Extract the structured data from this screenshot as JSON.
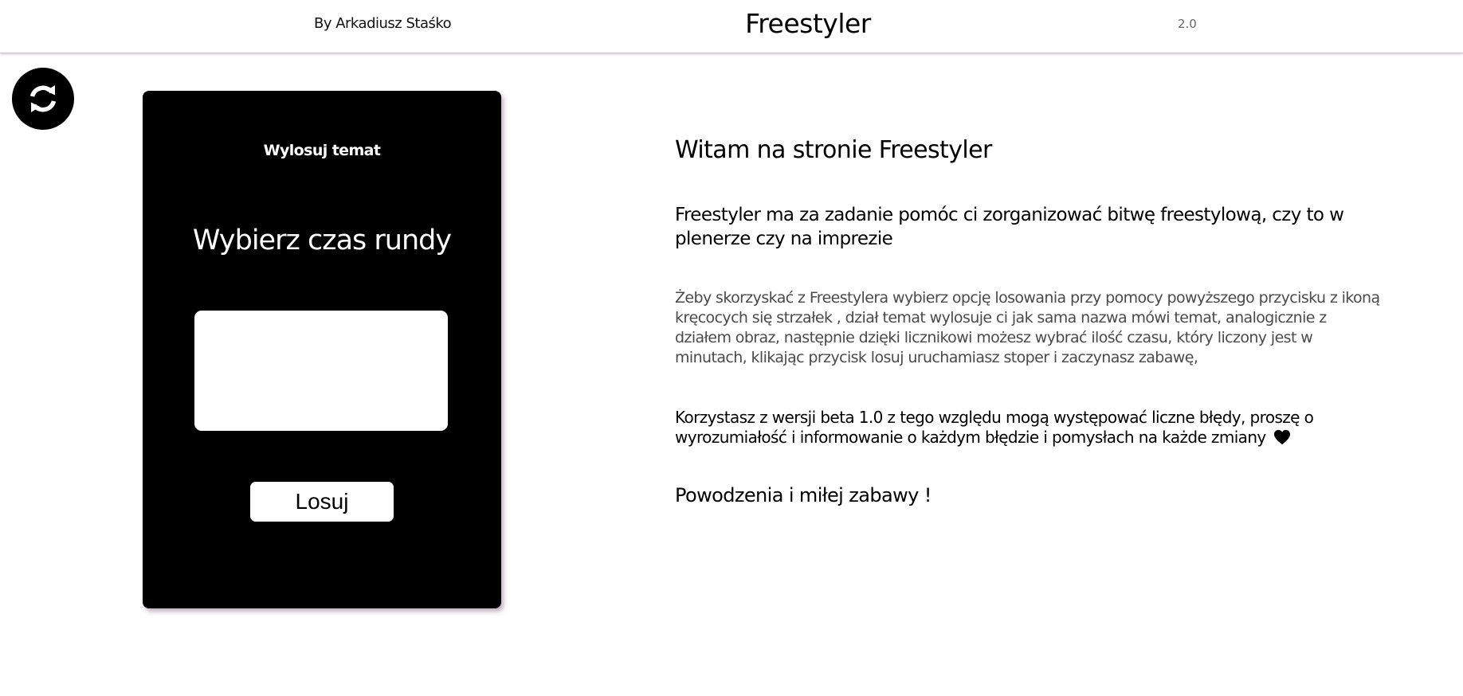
{
  "header": {
    "author": "By Arkadiusz Staśko",
    "title": "Freestyler",
    "version": "2.0"
  },
  "refresh": {
    "icon": "refresh-icon"
  },
  "card": {
    "draw_topic_label": "Wylosuj temat",
    "round_time_label": "Wybierz czas rundy",
    "time_input": {
      "value": "",
      "placeholder": ""
    },
    "draw_button_label": "Losuj"
  },
  "main": {
    "welcome": "Witam na stronie Freestyler",
    "intro": "Freestyler ma za zadanie pomóc ci zorganizować bitwę freestylową, czy to w plenerze czy na imprezie",
    "instructions": "Żeby skorzyskać z Freestylera wybierz opcję losowania przy pomocy powyższego przycisku z ikoną kręcocych się strzałek , dział temat wylosuje ci jak sama nazwa mówi temat, analogicznie z działem obraz, następnie dzięki licznikowi możesz wybrać ilość czasu, który liczony jest w minutach, klikając przycisk losuj uruchamiasz stoper i zaczynasz zabawę,",
    "beta_notice": "Korzystasz z wersji beta 1.0 z tego względu mogą występować liczne błędy, proszę o wyrozumiałość i informowanie o każdym błędzie i pomysłach na każde zmiany",
    "heart_icon": "heart-icon",
    "good_luck": "Powodzenia i miłej zabawy !"
  },
  "colors": {
    "card_background": "#000000",
    "card_shadow": "#7a5070",
    "page_background": "#ffffff",
    "muted_text": "#4a4a4a"
  }
}
